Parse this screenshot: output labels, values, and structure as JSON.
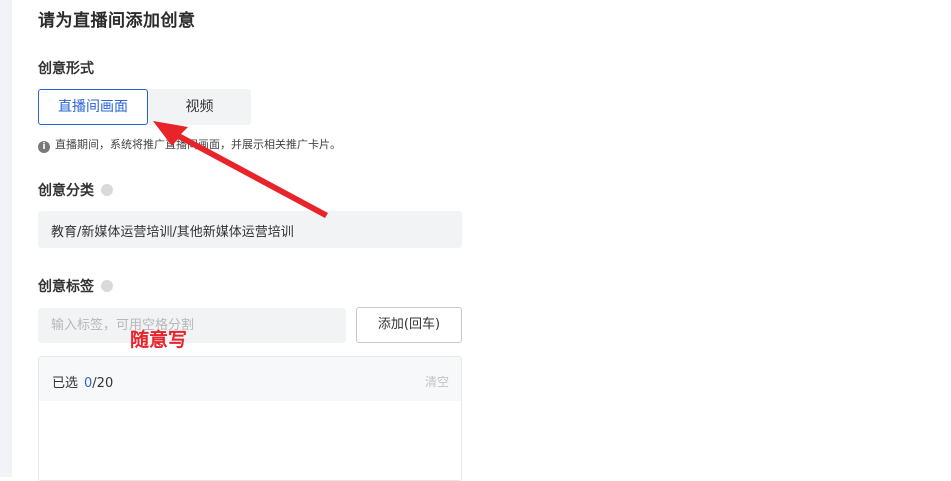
{
  "title": "请为直播间添加创意",
  "creative_form": {
    "label": "创意形式",
    "options": [
      "直播间画面",
      "视频"
    ],
    "selected": "直播间画面",
    "hint": "直播期间，系统将推广直播间画面，并展示相关推广卡片。"
  },
  "creative_category": {
    "label": "创意分类",
    "value": "教育/新媒体运营培训/其他新媒体运营培训"
  },
  "creative_tags": {
    "label": "创意标签",
    "input_placeholder": "输入标签，可用空格分割",
    "add_button": "添加(回车)",
    "selected_label": "已选",
    "selected_count": "0",
    "selected_max": "/20",
    "clear_label": "清空"
  },
  "annotation": {
    "text": "随意写",
    "color": "#e8232a"
  },
  "colors": {
    "accent": "#2a63d6",
    "annotation_red": "#e8232a"
  }
}
